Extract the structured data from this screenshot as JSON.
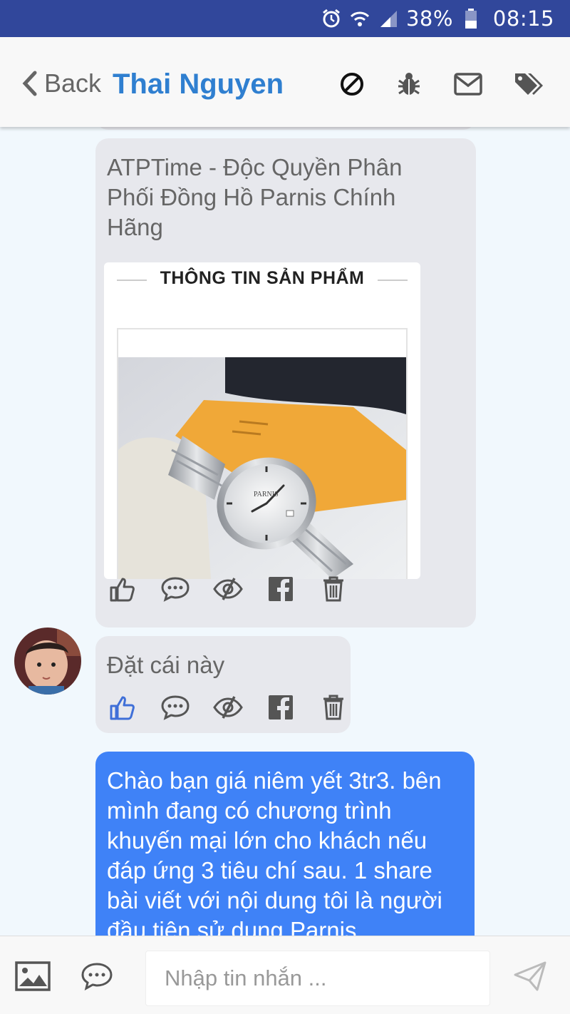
{
  "status_bar": {
    "battery_percent": "38%",
    "time": "08:15",
    "icons": [
      "alarm-icon",
      "wifi-icon",
      "signal-icon",
      "battery-icon"
    ]
  },
  "header": {
    "back_label": "Back",
    "title": "Thai Nguyen",
    "icons": [
      "block-icon",
      "bug-icon",
      "mail-icon",
      "tags-icon"
    ],
    "title_color": "#2f7fd0"
  },
  "messages": [
    {
      "direction": "incoming",
      "text": "ATPTime - Độc Quyền Phân Phối Đồng Hồ Parnis Chính Hãng",
      "attachment": {
        "header": "THÔNG TIN SẢN PHẨM",
        "image": "silver-watch-photo"
      },
      "actions": [
        "like-icon",
        "comment-icon",
        "hide-icon",
        "facebook-icon",
        "trash-icon"
      ],
      "liked": false
    },
    {
      "direction": "incoming",
      "sender_avatar": "child-avatar",
      "text": "Đặt cái này",
      "actions": [
        "like-icon",
        "comment-icon",
        "hide-icon",
        "facebook-icon",
        "trash-icon"
      ],
      "liked": true
    },
    {
      "direction": "outgoing",
      "text": "Chào bạn giá niêm yết 3tr3. bên mình đang có chương trình khuyến mại lớn cho khách nếu đáp ứng 3 tiêu chí sau. 1 share bài viết với nội dung tôi là người đầu tiên sử dụng Parnis"
    }
  ],
  "composer": {
    "placeholder": "Nhập tin nhắn ...",
    "value": "",
    "icons": [
      "image-icon",
      "chat-bubble-icon",
      "send-icon"
    ]
  },
  "colors": {
    "status_bar": "#31479b",
    "outgoing_bubble": "#3f82f7",
    "incoming_bubble": "#e7e8ed",
    "liked": "#3f6fd8",
    "background": "#f1f8fd"
  }
}
